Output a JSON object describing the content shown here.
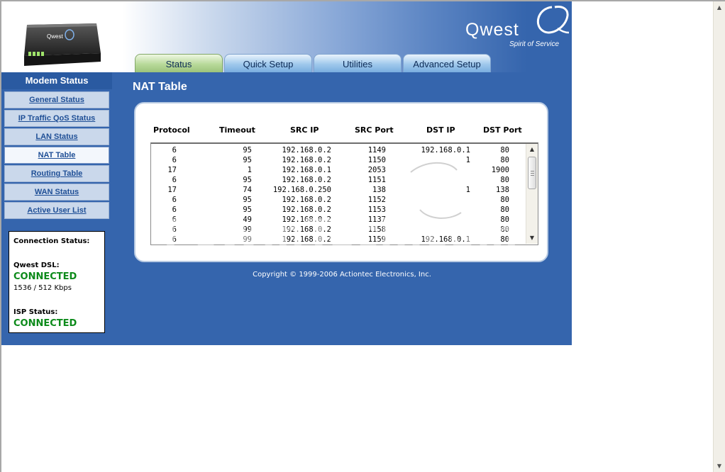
{
  "brand": {
    "name": "Qwest",
    "tagline": "Spirit of Service",
    "device_label": "Qwest",
    "colors": {
      "background": "#3565ad",
      "tab_active": "#b8d99a",
      "tab": "#9fc8ec",
      "connected": "#0c8a1a"
    }
  },
  "tabs": [
    {
      "label": "Status",
      "active": true
    },
    {
      "label": "Quick Setup",
      "active": false
    },
    {
      "label": "Utilities",
      "active": false
    },
    {
      "label": "Advanced Setup",
      "active": false
    }
  ],
  "sidebar": {
    "title": "Modem Status",
    "items": [
      {
        "label": "General Status",
        "active": false
      },
      {
        "label": "IP Traffic QoS Status",
        "active": false
      },
      {
        "label": "LAN Status",
        "active": false
      },
      {
        "label": "NAT Table",
        "active": true
      },
      {
        "label": "Routing Table",
        "active": false
      },
      {
        "label": "WAN Status",
        "active": false
      },
      {
        "label": "Active User List",
        "active": false
      }
    ]
  },
  "connection": {
    "title": "Connection Status:",
    "dsl_label": "Qwest DSL:",
    "dsl_status": "CONNECTED",
    "dsl_rate": "1536 / 512 Kbps",
    "isp_label": "ISP Status:",
    "isp_status": "CONNECTED"
  },
  "main": {
    "title": "NAT Table",
    "columns": [
      "Protocol",
      "Timeout",
      "SRC IP",
      "SRC Port",
      "DST IP",
      "DST Port"
    ],
    "rows": [
      [
        "6",
        "95",
        "192.168.0.2",
        "1149",
        "192.168.0.1",
        "80"
      ],
      [
        "6",
        "95",
        "192.168.0.2",
        "1150",
        "1",
        "80"
      ],
      [
        "17",
        "1",
        "192.168.0.1",
        "2053",
        "",
        "1900"
      ],
      [
        "6",
        "95",
        "192.168.0.2",
        "1151",
        "",
        "80"
      ],
      [
        "17",
        "74",
        "192.168.0.250",
        "138",
        "1",
        "138"
      ],
      [
        "6",
        "95",
        "192.168.0.2",
        "1152",
        "",
        "80"
      ],
      [
        "6",
        "95",
        "192.168.0.2",
        "1153",
        "",
        "80"
      ],
      [
        "6",
        "49",
        "192.168.0.2",
        "1137",
        "",
        "80"
      ],
      [
        "6",
        "99",
        "192.168.0.2",
        "1158",
        "",
        "80"
      ],
      [
        "6",
        "99",
        "192.168.0.2",
        "1159",
        "192.168.0.1",
        "80"
      ]
    ]
  },
  "copyright": "Copyright © 1999-2006 Actiontec Electronics, Inc.",
  "watermark": "PcWinTech.com"
}
